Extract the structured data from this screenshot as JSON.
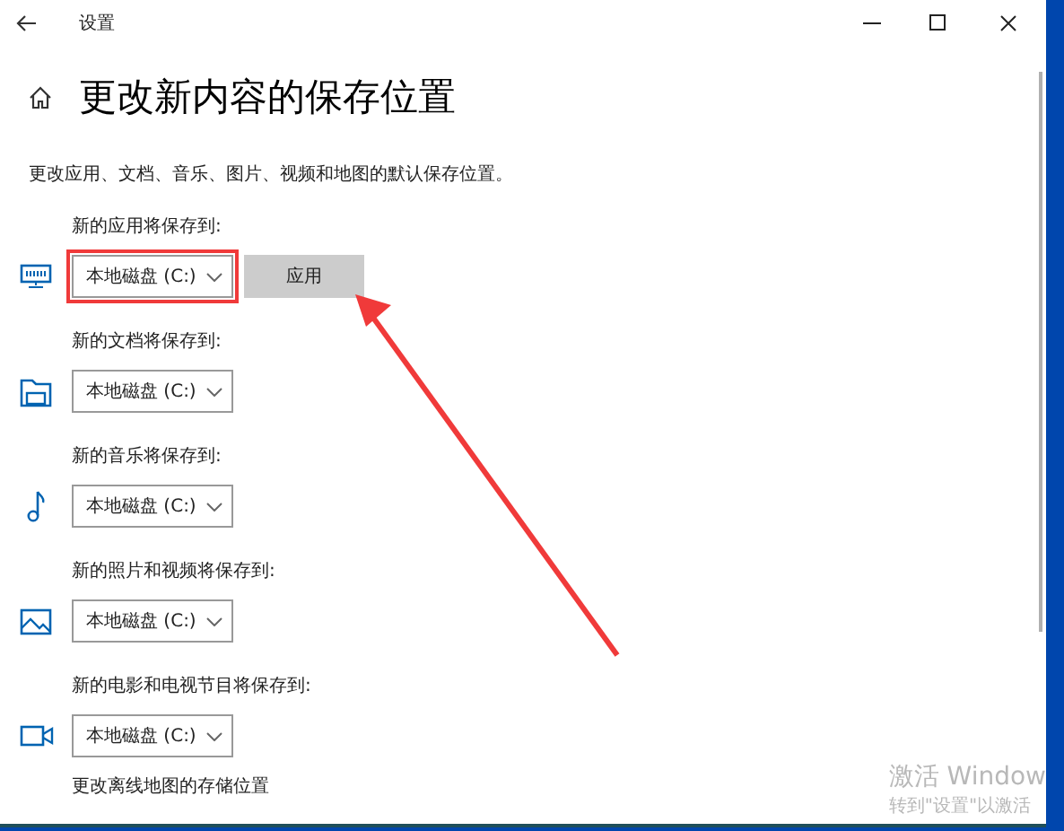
{
  "window": {
    "title": "设置"
  },
  "page": {
    "heading": "更改新内容的保存位置",
    "description": "更改应用、文档、音乐、图片、视频和地图的默认保存位置。"
  },
  "sections": [
    {
      "kind": "apps",
      "label": "新的应用将保存到:",
      "value": "本地磁盘 (C:)",
      "highlighted": true,
      "button": "应用"
    },
    {
      "kind": "documents",
      "label": "新的文档将保存到:",
      "value": "本地磁盘 (C:)",
      "highlighted": false
    },
    {
      "kind": "music",
      "label": "新的音乐将保存到:",
      "value": "本地磁盘 (C:)",
      "highlighted": false
    },
    {
      "kind": "photos",
      "label": "新的照片和视频将保存到:",
      "value": "本地磁盘 (C:)",
      "highlighted": false
    },
    {
      "kind": "movies",
      "label": "新的电影和电视节目将保存到:",
      "value": "本地磁盘 (C:)",
      "highlighted": false
    }
  ],
  "offline_maps": {
    "label": "更改离线地图的存储位置"
  },
  "activation": {
    "title": "激活 Window",
    "subtitle": "转到\"设置\"以激活"
  }
}
